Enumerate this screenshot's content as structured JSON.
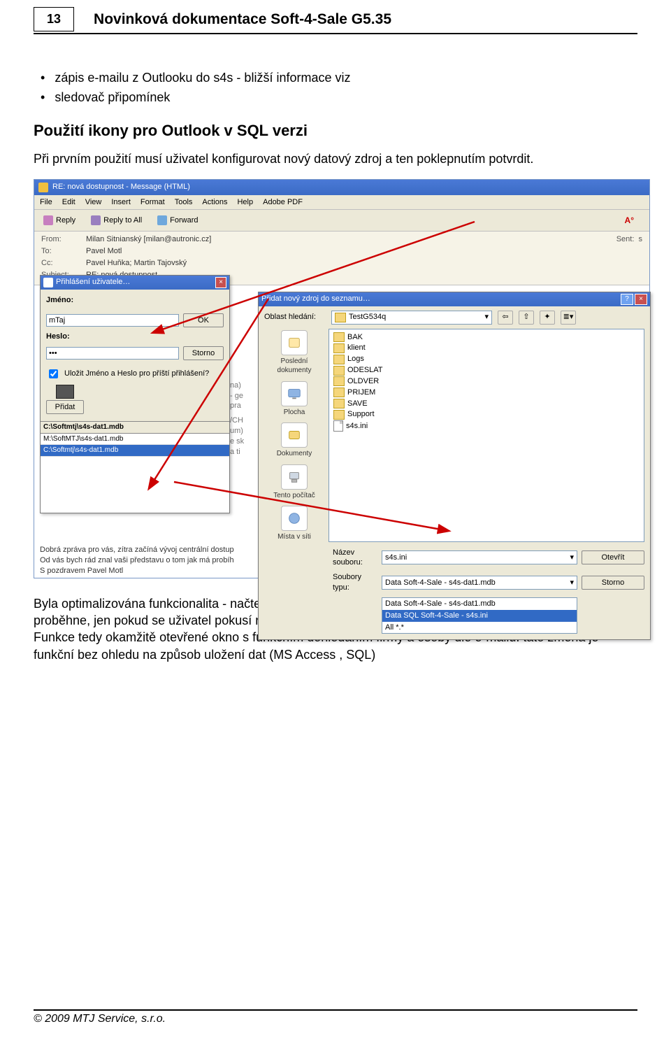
{
  "page_number": "13",
  "doc_title": "Novinková dokumentace Soft-4-Sale G5.35",
  "bullets": [
    "zápis e-mailu z Outlooku do s4s - bližší informace viz",
    "sledovač připomínek"
  ],
  "section_heading": "Použití ikony pro Outlook v SQL verzi",
  "intro_text": "Při prvním použití musí uživatel konfigurovat nový datový zdroj a ten poklepnutím potvrdit.",
  "closing_text": "Byla optimalizována funkcionalita - načtení seznamu firem, zakázek a marketingových akcí (teploměr) proběhne, jen pokud se uživatel pokusí rozevřít příslušnou nabídku firem, zakázek, marketingových akcí. Funkce tedy okamžitě otevřené okno s funkčním dohledáním firmy a osoby dle e-mailu. tato změna je funkční bez ohledu na způsob uložení dat (MS Access , SQL)",
  "footer": "© 2009 MTJ Service, s.r.o.",
  "outlook": {
    "title": "RE: nová dostupnost - Message (HTML)",
    "menus": [
      "File",
      "Edit",
      "View",
      "Insert",
      "Format",
      "Tools",
      "Actions",
      "Help",
      "Adobe PDF"
    ],
    "toolbar": {
      "reply": "Reply",
      "reply_all": "Reply to All",
      "forward": "Forward"
    },
    "headers": {
      "from_label": "From:",
      "from_value": "Milan Sitnianský [milan@autronic.cz]",
      "to_label": "To:",
      "to_value": "Pavel Motl",
      "cc_label": "Cc:",
      "cc_value": "Pavel Huňka; Martin Tajovský",
      "subject_label": "Subject:",
      "subject_value": "RE: nová dostupnost",
      "sent_label": "Sent:",
      "sent_value": "s"
    },
    "behind_fragments": [
      "na)",
      "- ge",
      "pra",
      "/CH",
      "um)",
      "e sk",
      "a ti"
    ],
    "body_lines": [
      "Dobrá zpráva pro vás, zítra začíná vývoj centrální dostup",
      "Od vás bych rád znal vaši představu o tom jak má probíh",
      "S pozdravem Pavel Motl"
    ]
  },
  "login": {
    "title": "Přihlášení uživatele…",
    "jmeno_label": "Jméno:",
    "jmeno_value": "mTaj",
    "heslo_label": "Heslo:",
    "heslo_value": "***",
    "ok": "OK",
    "storno": "Storno",
    "save_text": "Uložit Jméno a Heslo pro příští přihlášení?",
    "pridat": "Přidat",
    "paths_header": "C:\\Softmtj\\s4s-dat1.mdb",
    "paths": [
      "M:\\SoftMTJ\\s4s-dat1.mdb",
      "C:\\Softmtj\\s4s-dat1.mdb"
    ]
  },
  "ds": {
    "title": "Přidat nový zdroj do seznamu…",
    "hledani_label": "Oblast hledání:",
    "hledani_value": "TestG534q",
    "sidebar": {
      "recent": "Poslední dokumenty",
      "desktop": "Plocha",
      "docs": "Dokumenty",
      "computer": "Tento počítač",
      "network": "Místa v síti"
    },
    "folders": [
      "BAK",
      "klient",
      "Logs",
      "ODESLAT",
      "OLDVER",
      "PRIJEM",
      "SAVE",
      "Support"
    ],
    "ini_file": "s4s.ini",
    "name_label": "Název souboru:",
    "name_value": "s4s.ini",
    "type_label": "Soubory typu:",
    "type_options": [
      "Data Soft-4-Sale - s4s-dat1.mdb",
      "Data SQL Soft-4-Sale - s4s.ini",
      "All *.*"
    ],
    "type_selected_index": 1,
    "open": "Otevřít",
    "cancel": "Storno"
  }
}
